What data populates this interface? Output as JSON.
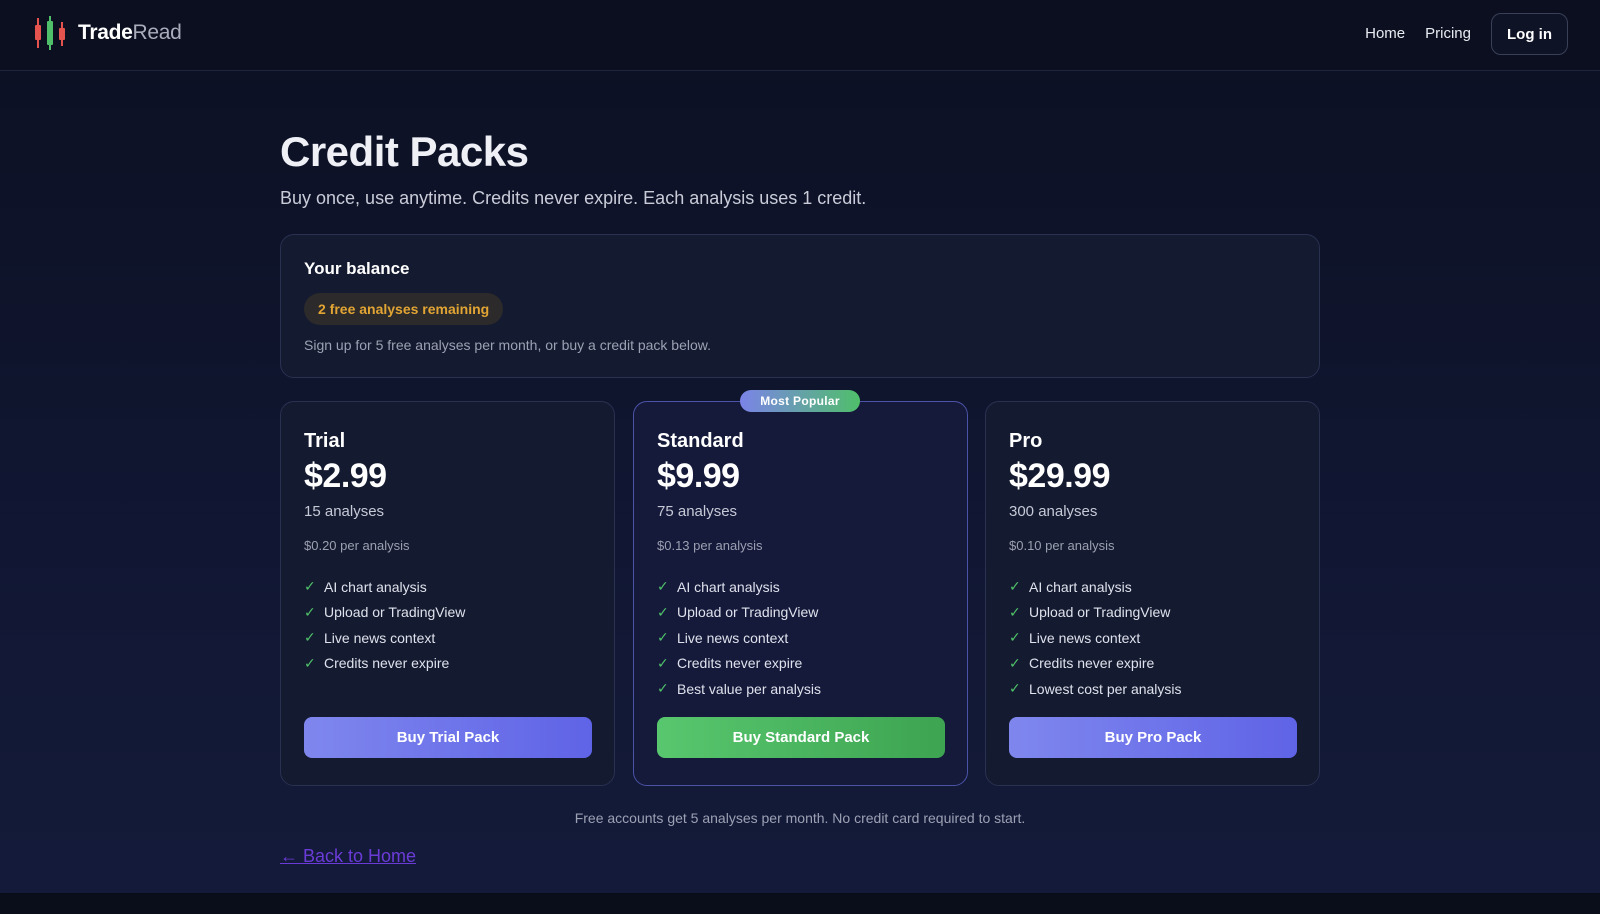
{
  "header": {
    "logo_icon": "candlestick-icon",
    "brand_part1": "Trade",
    "brand_part2": "Read",
    "nav": [
      {
        "label": "Home"
      },
      {
        "label": "Pricing"
      }
    ],
    "login_label": "Log in"
  },
  "page": {
    "title": "Credit Packs",
    "subtitle": "Buy once, use anytime. Credits never expire. Each analysis uses 1 credit."
  },
  "balance": {
    "title": "Your balance",
    "pill": "2 free analyses remaining",
    "note": "Sign up for 5 free analyses per month, or buy a credit pack below."
  },
  "packs": [
    {
      "name": "Trial",
      "price": "$2.99",
      "count": "15 analyses",
      "per": "$0.20 per analysis",
      "features": [
        "AI chart analysis",
        "Upload or TradingView",
        "Live news context",
        "Credits never expire"
      ],
      "button": "Buy Trial Pack"
    },
    {
      "badge": "Most Popular",
      "name": "Standard",
      "price": "$9.99",
      "count": "75 analyses",
      "per": "$0.13 per analysis",
      "features": [
        "AI chart analysis",
        "Upload or TradingView",
        "Live news context",
        "Credits never expire",
        "Best value per analysis"
      ],
      "button": "Buy Standard Pack"
    },
    {
      "name": "Pro",
      "price": "$29.99",
      "count": "300 analyses",
      "per": "$0.10 per analysis",
      "features": [
        "AI chart analysis",
        "Upload or TradingView",
        "Live news context",
        "Credits never expire",
        "Lowest cost per analysis"
      ],
      "button": "Buy Pro Pack"
    }
  ],
  "check_icon": "checkmark-icon",
  "footnote": "Free accounts get 5 analyses per month. No credit card required to start.",
  "back_link": "← Back to Home",
  "colors": {
    "accent_purple": "#6366f1",
    "accent_green": "#4fbf6a",
    "pill_text": "#e2a534",
    "background": "#0c1022"
  }
}
